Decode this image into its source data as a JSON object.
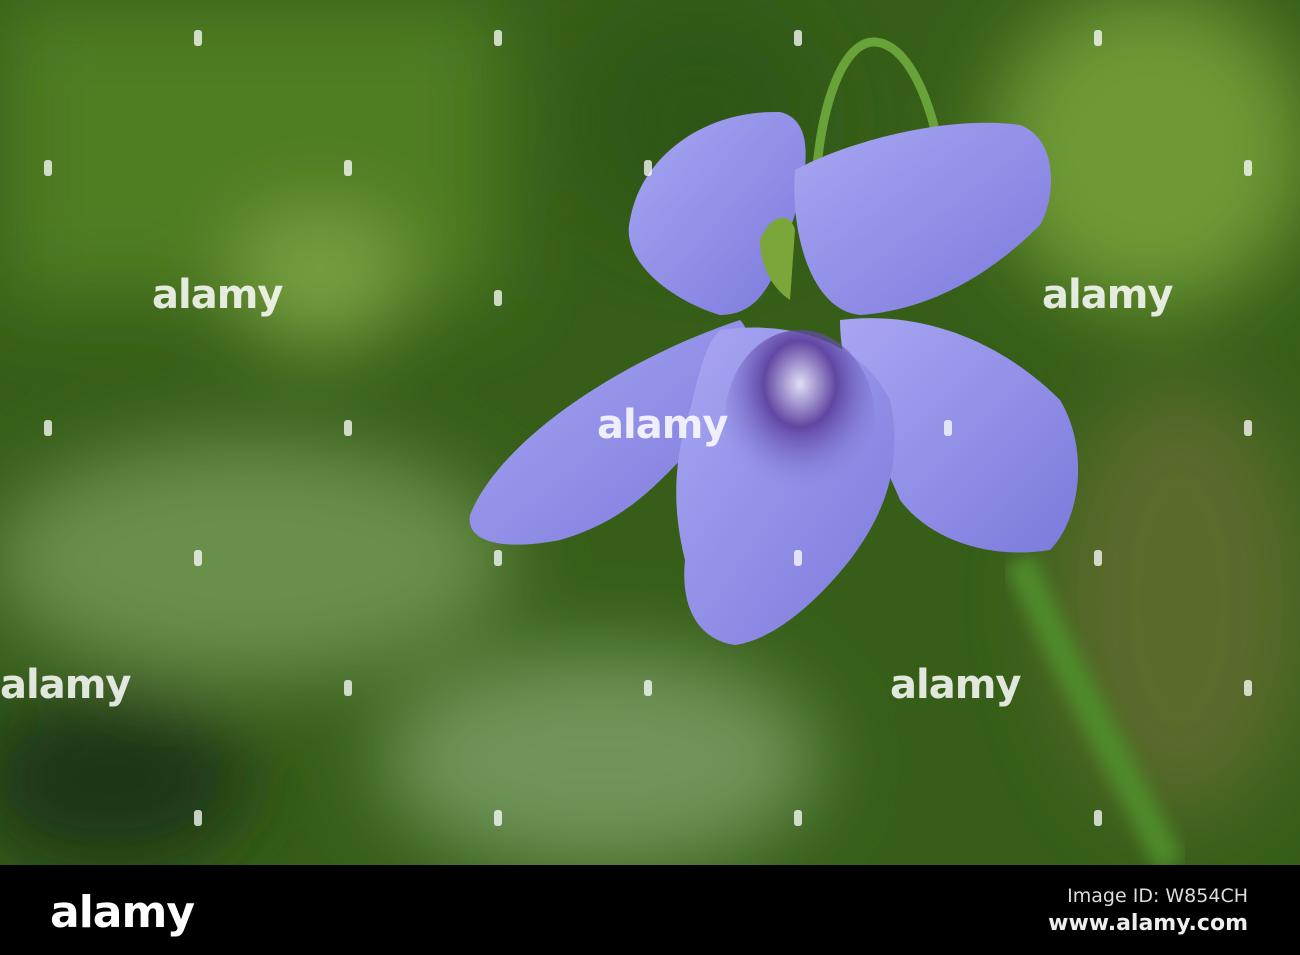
{
  "photo": {
    "subject": "violet-flower"
  },
  "watermark": {
    "text": "alamy"
  },
  "footer": {
    "logo": "alamy",
    "image_id": "Image ID: W854CH",
    "site": "www.alamy.com"
  },
  "colors": {
    "petal": "#8f8ee8",
    "background": "#3f6a1e",
    "bar": "#000000"
  }
}
